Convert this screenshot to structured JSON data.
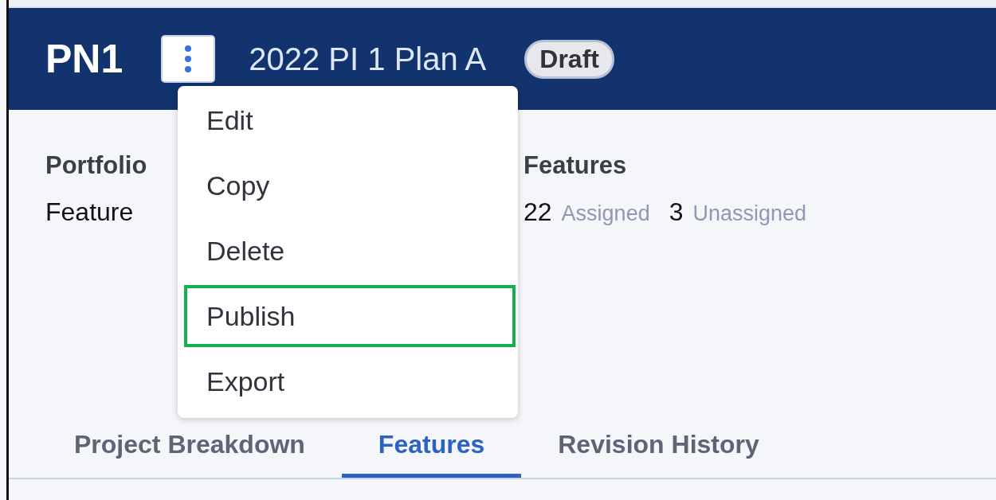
{
  "header": {
    "code": "PN1",
    "title": "2022 PI 1 Plan A",
    "status": "Draft"
  },
  "menu": {
    "open": true,
    "items": [
      {
        "label": "Edit",
        "selected": false
      },
      {
        "label": "Copy",
        "selected": false
      },
      {
        "label": "Delete",
        "selected": false
      },
      {
        "label": "Publish",
        "selected": true
      },
      {
        "label": "Export",
        "selected": false
      }
    ]
  },
  "fields": [
    {
      "label": "Portfolio",
      "value": "Feature"
    },
    {
      "label": "Features",
      "stats": [
        {
          "count": "22",
          "label": "Assigned"
        },
        {
          "count": "3",
          "label": "Unassigned"
        }
      ]
    }
  ],
  "tabs": [
    {
      "label": "Project Breakdown",
      "selected": false
    },
    {
      "label": "Features",
      "selected": true
    },
    {
      "label": "Revision History",
      "selected": false
    }
  ]
}
